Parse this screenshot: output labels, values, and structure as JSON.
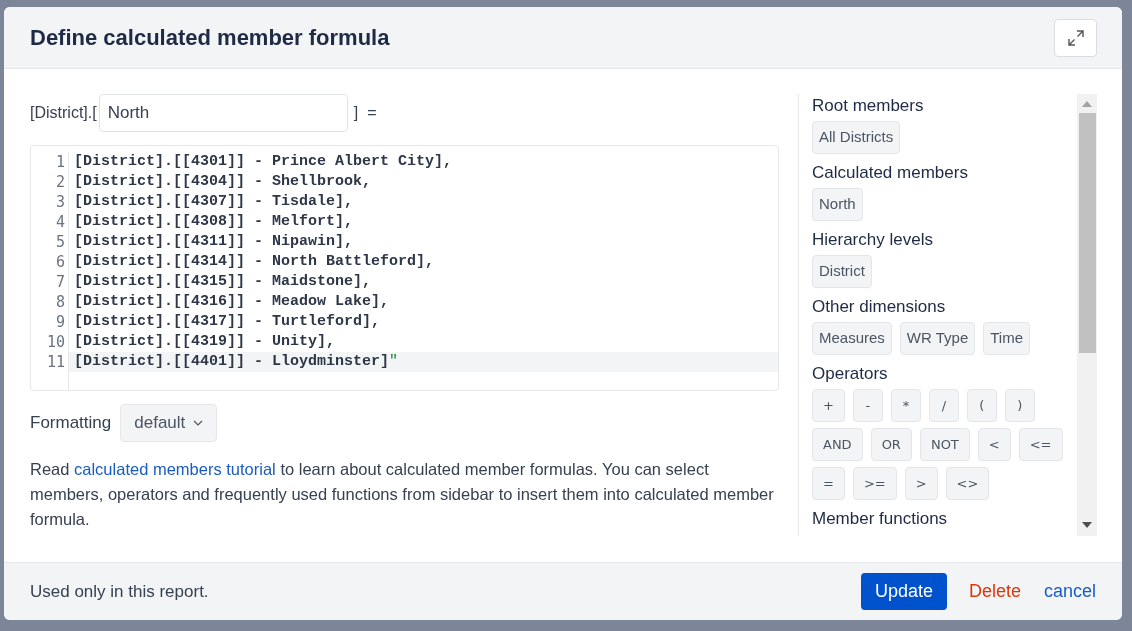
{
  "dialog": {
    "title": "Define calculated member formula",
    "name_row": {
      "prefix": "[District].[",
      "value": "North",
      "suffix": "]",
      "equals": "="
    },
    "code_lines": [
      {
        "number": "1",
        "text": "[District].[[4301]] - Prince Albert City],",
        "current": false
      },
      {
        "number": "2",
        "text": "[District].[[4304]] - Shellbrook,",
        "current": false
      },
      {
        "number": "3",
        "text": "[District].[[4307]] - Tisdale],",
        "current": false
      },
      {
        "number": "4",
        "text": "[District].[[4308]] - Melfort],",
        "current": false
      },
      {
        "number": "5",
        "text": "[District].[[4311]] - Nipawin],",
        "current": false
      },
      {
        "number": "6",
        "text": "[District].[[4314]] - North Battleford],",
        "current": false
      },
      {
        "number": "7",
        "text": "[District].[[4315]] - Maidstone],",
        "current": false
      },
      {
        "number": "8",
        "text": "[District].[[4316]] - Meadow Lake],",
        "current": false
      },
      {
        "number": "9",
        "text": "[District].[[4317]] - Turtleford],",
        "current": false
      },
      {
        "number": "10",
        "text": "[District].[[4319]] - Unity],",
        "current": false
      },
      {
        "number": "11",
        "text": "[District].[[4401]] - Lloydminster]",
        "string_tail": "\"",
        "current": true
      }
    ],
    "formatting": {
      "label": "Formatting",
      "value": "default"
    },
    "help": {
      "before": "Read ",
      "link": "calculated members tutorial",
      "after": " to learn about calculated member formulas. You can select members, operators and frequently used functions from sidebar to insert them into calculated member formula."
    },
    "sidebar": [
      {
        "heading": "Root members",
        "items": [
          "All Districts"
        ]
      },
      {
        "heading": "Calculated members",
        "items": [
          "North"
        ]
      },
      {
        "heading": "Hierarchy levels",
        "items": [
          "District"
        ]
      },
      {
        "heading": "Other dimensions",
        "items": [
          "Measures",
          "WR Type",
          "Time"
        ]
      },
      {
        "heading": "Operators",
        "kind": "operators",
        "items": [
          "+",
          "-",
          "*",
          "/",
          "(",
          ")",
          "AND",
          "OR",
          "NOT",
          "<",
          "<=",
          "=",
          ">=",
          ">",
          "<>"
        ]
      },
      {
        "heading": "Member functions"
      }
    ],
    "footer": {
      "note": "Used only in this report.",
      "update": "Update",
      "delete": "Delete",
      "cancel": "cancel"
    }
  }
}
